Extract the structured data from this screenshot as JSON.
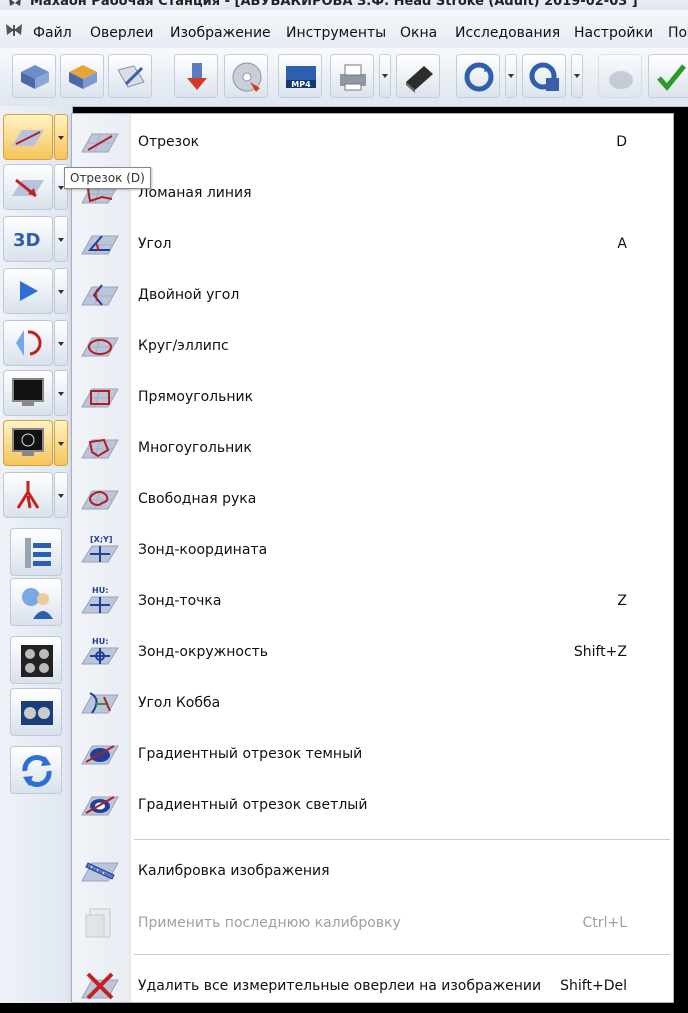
{
  "window": {
    "title": "Махаон Рабочая Станция - [АБУБАКИРОВА З.Ф. Head Stroke (Adult) 2019-02-03 ]"
  },
  "menubar": {
    "items": [
      "Файл",
      "Оверлеи",
      "Изображение",
      "Инструменты",
      "Окна",
      "Исследования",
      "Настройки",
      "По"
    ]
  },
  "tooltip": {
    "text": "Отрезок (D)"
  },
  "menu": {
    "items": [
      {
        "label": "Отрезок",
        "shortcut": "D",
        "icon": "segment-icon"
      },
      {
        "label": "Ломаная линия",
        "shortcut": "",
        "icon": "polyline-icon"
      },
      {
        "label": "Угол",
        "shortcut": "A",
        "icon": "angle-icon"
      },
      {
        "label": "Двойной угол",
        "shortcut": "",
        "icon": "double-angle-icon"
      },
      {
        "label": "Круг/эллипс",
        "shortcut": "",
        "icon": "ellipse-icon"
      },
      {
        "label": "Прямоугольник",
        "shortcut": "",
        "icon": "rectangle-icon"
      },
      {
        "label": "Многоугольник",
        "shortcut": "",
        "icon": "polygon-icon"
      },
      {
        "label": "Свободная рука",
        "shortcut": "",
        "icon": "freehand-icon"
      },
      {
        "label": "Зонд-координата",
        "shortcut": "",
        "icon": "probe-coordinate-icon",
        "badge": "[X;Y]"
      },
      {
        "label": "Зонд-точка",
        "shortcut": "Z",
        "icon": "probe-point-icon",
        "badge": "HU:"
      },
      {
        "label": "Зонд-окружность",
        "shortcut": "Shift+Z",
        "icon": "probe-circle-icon",
        "badge": "HU:"
      },
      {
        "label": "Угол Кобба",
        "shortcut": "",
        "icon": "cobb-angle-icon"
      },
      {
        "label": "Градиентный отрезок темный",
        "shortcut": "",
        "icon": "gradient-dark-icon"
      },
      {
        "label": "Градиентный отрезок светлый",
        "shortcut": "",
        "icon": "gradient-light-icon"
      }
    ],
    "calibration": {
      "label": "Калибровка изображения",
      "shortcut": "",
      "icon": "calibration-icon"
    },
    "apply_calibration": {
      "label": "Применить последнюю калибровку",
      "shortcut": "Ctrl+L",
      "icon": "apply-calibration-icon",
      "disabled": true
    },
    "delete_all": {
      "label": "Удалить все измерительные оверлеи на изображении",
      "shortcut": "Shift+Del",
      "icon": "delete-cross-icon"
    }
  },
  "toolbar_badges": {
    "mp4": "MP4"
  },
  "sidebar_badges": {
    "three_d": "3D"
  },
  "colors": {
    "menu_bg": "#ffffff",
    "gutter": "#eef1f5",
    "active_tool": "#f5c45a",
    "disabled_text": "#a0a0a0",
    "grid": "#aeb8cc",
    "line_red": "#c42020",
    "line_blue": "#1f3f9a"
  }
}
